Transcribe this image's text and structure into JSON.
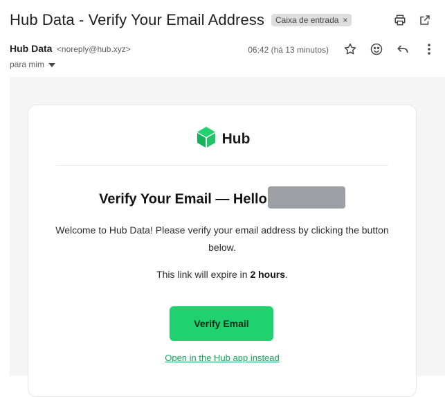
{
  "email": {
    "subject": "Hub Data - Verify Your Email Address",
    "label_chip": "Caixa de entrada",
    "label_remove": "×",
    "sender_name": "Hub Data",
    "sender_email": "<noreply@hub.xyz>",
    "recipient": "para mim",
    "timestamp": "06:42 (há 13 minutos)"
  },
  "toolbar_icons": [
    "print-icon",
    "open-in-new-window-icon",
    "star-icon",
    "emoji-icon",
    "reply-icon",
    "more-options-icon"
  ],
  "message": {
    "brand_name": "Hub",
    "heading": "Verify Your Email — Hello",
    "welcome_text": "Welcome to Hub Data! Please verify your email address by clicking the button below.",
    "expire_prefix": "This link will expire in ",
    "expire_duration": "2 hours",
    "expire_suffix": ".",
    "verify_button": "Verify Email",
    "app_link": "Open in the Hub app instead"
  },
  "colors": {
    "accent_green": "#1fd16f",
    "link_green": "#12a35a",
    "chip_bg": "#dddddd",
    "redaction": "#9ea0a5"
  }
}
